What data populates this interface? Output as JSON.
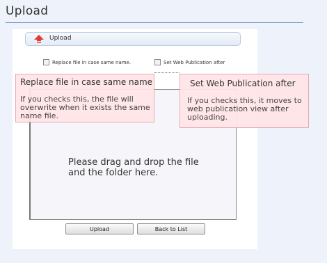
{
  "page": {
    "title": "Upload"
  },
  "upload_panel": {
    "header_label": "Upload",
    "options": [
      {
        "label": "Replace file in case same name.",
        "checked": false
      },
      {
        "label": "Set Web Publication after",
        "checked": false
      }
    ],
    "drop_area_text": "Please drag and drop the file and the folder here.",
    "buttons": {
      "upload": "Upload",
      "back": "Back to List"
    }
  },
  "tooltips": [
    {
      "title": "Replace file in case same name",
      "body": "If you checks this, the file will overwrite when it exists the same name file."
    },
    {
      "title": "Set Web Publication after",
      "body": "If you checks this, it moves to web publication view after uploading."
    }
  ],
  "colors": {
    "page_bg": "#eef2fa",
    "panel_bg": "#ffffff",
    "tooltip_bg": "#ffe4e6",
    "tooltip_border": "#e9a8ad",
    "upload_arrow": "#e23a2c"
  },
  "icons": {
    "upload_header": "up-arrow-icon"
  }
}
